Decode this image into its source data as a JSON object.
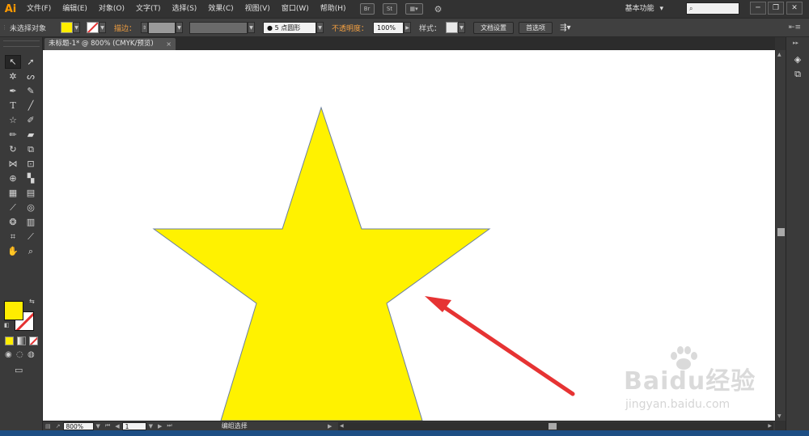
{
  "app": {
    "logo": "Ai"
  },
  "menu": [
    "文件(F)",
    "编辑(E)",
    "对象(O)",
    "文字(T)",
    "选择(S)",
    "效果(C)",
    "视图(V)",
    "窗口(W)",
    "帮助(H)"
  ],
  "menu_icons": {
    "bridge": "Br",
    "stock": "St"
  },
  "workspace": {
    "label": "基本功能",
    "arrow": "▾"
  },
  "search": {
    "placeholder": ""
  },
  "window_controls": {
    "minimize": "─",
    "restore": "❐",
    "close": "✕"
  },
  "control_bar": {
    "selection_label": "未选择对象",
    "fill_color": "#ffed00",
    "stroke_label": "描边：",
    "brush_label": "5 点圆形",
    "opacity_label": "不透明度：",
    "opacity_value": "100%",
    "style_label": "样式：",
    "doc_setup_button": "文档设置",
    "preferences_button": "首选项"
  },
  "document_tab": {
    "title": "未标题-1* @ 800% (CMYK/预览)",
    "close": "×"
  },
  "tools": {
    "type_tool": "T",
    "fill_color": "#ffed00",
    "stroke_color": "none"
  },
  "status_bar": {
    "zoom": "800%",
    "artboard": "1",
    "status_text": "编组选择"
  },
  "canvas": {
    "star_fill": "#fff200",
    "star_stroke": "#6b7fa0",
    "arrow_color": "#e63333"
  },
  "watermark": {
    "brand": "Baidu经验",
    "url": "jingyan.baidu.com"
  }
}
